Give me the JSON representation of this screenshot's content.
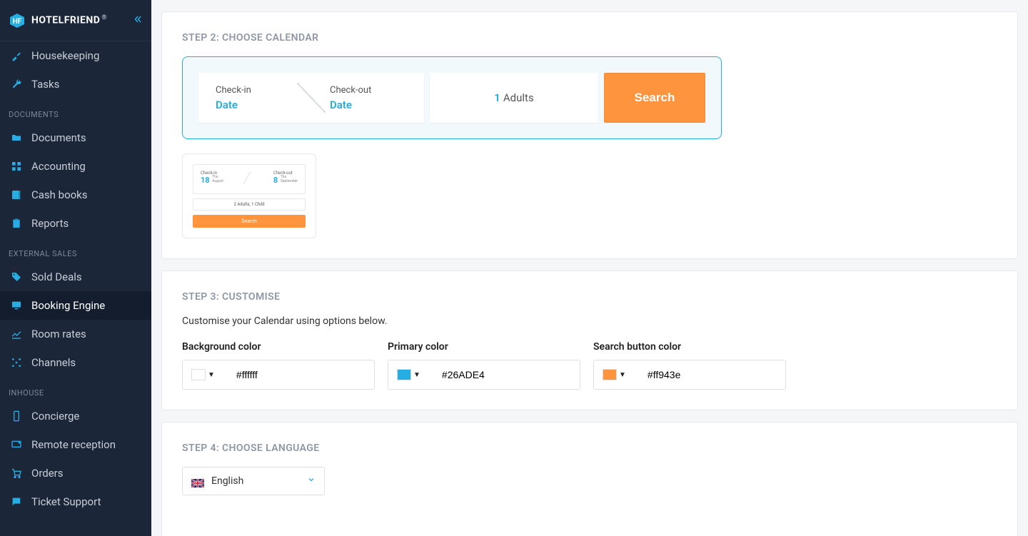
{
  "brand": {
    "name": "HOTELFRIEND",
    "reg": "®"
  },
  "sidebar": {
    "items_top": [
      {
        "label": "Housekeeping",
        "icon": "broom-icon"
      },
      {
        "label": "Tasks",
        "icon": "wrench-icon"
      }
    ],
    "section_documents_label": "DOCUMENTS",
    "items_documents": [
      {
        "label": "Documents",
        "icon": "folder-icon"
      },
      {
        "label": "Accounting",
        "icon": "grid-icon"
      },
      {
        "label": "Cash books",
        "icon": "book-icon"
      },
      {
        "label": "Reports",
        "icon": "clipboard-icon"
      }
    ],
    "section_external_label": "EXTERNAL SALES",
    "items_external": [
      {
        "label": "Sold Deals",
        "icon": "tag-icon"
      },
      {
        "label": "Booking Engine",
        "icon": "monitor-icon",
        "active": true
      },
      {
        "label": "Room rates",
        "icon": "chart-icon"
      },
      {
        "label": "Channels",
        "icon": "nodes-icon"
      }
    ],
    "section_inhouse_label": "INHOUSE",
    "items_inhouse": [
      {
        "label": "Concierge",
        "icon": "phone-icon"
      },
      {
        "label": "Remote reception",
        "icon": "reception-icon"
      },
      {
        "label": "Orders",
        "icon": "cart-icon"
      },
      {
        "label": "Ticket Support",
        "icon": "chat-icon"
      }
    ]
  },
  "step2": {
    "title": "STEP 2: CHOOSE CALENDAR",
    "large": {
      "checkin_label": "Check-in",
      "checkin_value": "Date",
      "checkout_label": "Check-out",
      "checkout_value": "Date",
      "guests_num": "1",
      "guests_label": "Adults",
      "search": "Search"
    },
    "small": {
      "checkin_label": "Check-in",
      "checkin_day": "18",
      "checkin_dow": "Thu",
      "checkin_month": "August",
      "checkout_label": "Check-out",
      "checkout_day": "8",
      "checkout_dow": "Thu",
      "checkout_month": "September",
      "guests": "2 Adults, 1 Child",
      "search": "Search"
    }
  },
  "step3": {
    "title": "STEP 3: CUSTOMISE",
    "subtitle": "Customise your Calendar using options below.",
    "bg_label": "Background color",
    "bg_value": "#ffffff",
    "bg_swatch": "#ffffff",
    "primary_label": "Primary color",
    "primary_value": "#26ADE4",
    "primary_swatch": "#26ADE4",
    "search_label": "Search button color",
    "search_value": "#ff943e",
    "search_swatch": "#ff943e"
  },
  "step4": {
    "title": "STEP 4: CHOOSE LANGUAGE",
    "language": "English"
  }
}
